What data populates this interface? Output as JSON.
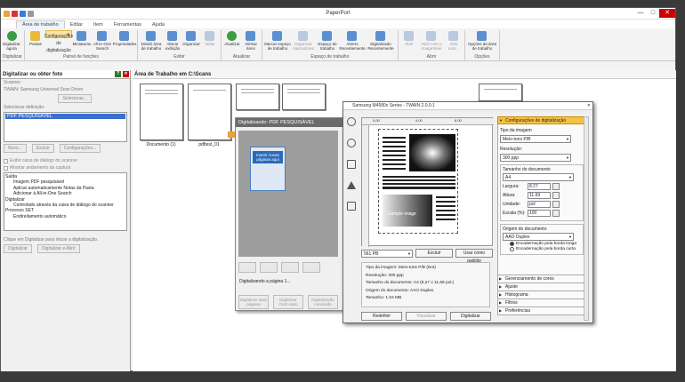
{
  "app": {
    "title": "PaperPort"
  },
  "ribbon_tabs": [
    "Área de trabalho",
    "Editar",
    "Item",
    "Ferramentas",
    "Ajuda"
  ],
  "ribbon_groups": [
    {
      "label": "Digitalizar",
      "buttons": [
        {
          "label": "Digitalizar agora",
          "icon": "scanner-icon"
        }
      ]
    },
    {
      "label": "Painel de funções",
      "buttons": [
        {
          "label": "Pastas",
          "icon": "folder-icon"
        },
        {
          "label": "Configurações de digitalização",
          "icon": "scan-settings-icon",
          "selected": true
        },
        {
          "label": "Miniaturas",
          "icon": "thumbnails-icon"
        },
        {
          "label": "All-in-One Search",
          "icon": "search-icon"
        },
        {
          "label": "Propriedades",
          "icon": "properties-icon"
        }
      ]
    },
    {
      "label": "Exibir",
      "buttons": [
        {
          "label": "Dividir área de trabalho",
          "icon": "split-icon"
        },
        {
          "label": "Alterar exibição",
          "icon": "view-icon"
        },
        {
          "label": "Organizar",
          "icon": "arrange-icon"
        },
        {
          "label": "Voltar",
          "icon": "back-icon",
          "disabled": true
        }
      ]
    },
    {
      "label": "Atualizar",
      "buttons": [
        {
          "label": "Atualizar",
          "icon": "refresh-icon"
        },
        {
          "label": "Alinhar itens",
          "icon": "align-icon"
        }
      ]
    },
    {
      "label": "Espaço de trabalho",
      "buttons": [
        {
          "label": "Marcar espaço de trabalho",
          "icon": "mark-icon"
        },
        {
          "label": "Organizar marcadores",
          "icon": "bookmarks-icon",
          "disabled": true
        },
        {
          "label": "Espaço de trabalho",
          "icon": "workspace-icon"
        },
        {
          "label": "Aberto Recentemente",
          "icon": "recent-icon"
        },
        {
          "label": "Digitalizado Recentemente",
          "icon": "recent-scan-icon"
        }
      ]
    },
    {
      "label": "Abrir",
      "buttons": [
        {
          "label": "Abrir",
          "icon": "open-icon",
          "disabled": true
        },
        {
          "label": "Abrir com o ImageView",
          "icon": "imageview-icon",
          "disabled": true
        },
        {
          "label": "Abrir com...",
          "icon": "open-with-icon",
          "disabled": true
        }
      ]
    },
    {
      "label": "Opções",
      "buttons": [
        {
          "label": "Opções da área de trabalho",
          "icon": "options-icon"
        }
      ]
    }
  ],
  "left": {
    "header": "Digitalizar ou obter foto",
    "scanner_label": "Scanner:",
    "scanner_value": "TWAIN: Samsung Universal Scan Driver",
    "select_button": "Selecionar...",
    "settings_label": "Selecionar definição:",
    "selected_setting": "PDF PESQUISÁVEL",
    "buttons": [
      "Novo...",
      "Excluir",
      "Configurações..."
    ],
    "checks": [
      "Exibir caixa de diálogo do scanner",
      "Mostrar andamento da captura"
    ],
    "output_items": [
      {
        "text": "Saída",
        "level": 0
      },
      {
        "text": "Imagem PDF pesquisável",
        "level": 1
      },
      {
        "text": "Aplicar automaticamente Notas da Pasta",
        "level": 1
      },
      {
        "text": "Adicionar à All-in-One Search",
        "level": 1
      },
      {
        "text": "Digitalizar",
        "level": 0
      },
      {
        "text": "Controlado através da caixa de diálogo do scanner",
        "level": 1
      },
      {
        "text": "Processo SET",
        "level": 0
      },
      {
        "text": "Endireitamento automático",
        "level": 1
      }
    ],
    "footer_label": "Clique em Digitalizar para iniciar a digitalização.",
    "footer_buttons": [
      "Digitalizar",
      "Digitalizar e Abrir"
    ]
  },
  "main": {
    "header": "Área de Trabalho em C:\\Scans",
    "items": [
      "Documento (1)",
      "pdftest_01"
    ]
  },
  "progress_dialog": {
    "title": "Digitalizando: PDF PESQUISÁVEL",
    "insert_label": "Inserir novas páginas aqui",
    "status": "Digitalizando a página 1...",
    "buttons": [
      "Digitalizar Mais páginas",
      "Digitalizar Outro lado",
      "Digitalização concluída"
    ]
  },
  "scan_dialog": {
    "title": "Samsung M4580x Series - TWAIN 2.0.0.1",
    "size_value": "561 PB",
    "exclude_button": "Excluir",
    "default_button": "Usar como padrão",
    "info": [
      "Tipo da imagem: Meio-tons P/B (Not)",
      "Resolução: 300 ppp",
      "Tamanho do documento: A4 (8,27 x 11,69 pol.)",
      "Origem do documento: AAO Duplex",
      "Tamanho: 1.04 MB"
    ],
    "footer_buttons": [
      "Redefinir",
      "Visualizar",
      "Digitalizar"
    ],
    "panel_header": "Configurações de digitalização",
    "image_type_label": "Tipo da imagem",
    "image_type_value": "Meio-tons P/B",
    "resolution_label": "Resolução:",
    "resolution_value": "300 ppp",
    "doc_size_label": "Tamanho do documento",
    "doc_size_value": "A4",
    "width_label": "Largura:",
    "width_value": "8.27",
    "height_label": "Altura:",
    "height_value": "11.69",
    "unit_label": "Unidade:",
    "unit_value": "pol",
    "scale_label": "Escala (%):",
    "scale_value": "100",
    "origin_label": "Origem do documento",
    "origin_value": "AAO Duplex",
    "binding": [
      "Encadernação pela borda longa",
      "Encadernação pela borda curta"
    ],
    "sections": [
      "Gerenciamento de cores",
      "Ajuste",
      "Histograma",
      "Filtros",
      "Preferências"
    ],
    "ruler_marks": [
      "0,00",
      "4,00",
      "8,00"
    ],
    "preview_text": "Sample image"
  }
}
